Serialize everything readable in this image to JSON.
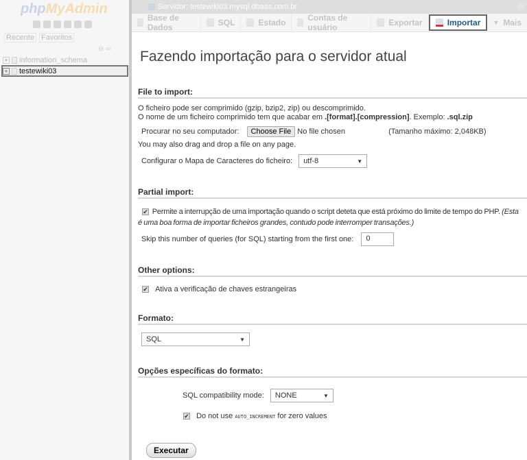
{
  "sidebar": {
    "logo_a": "php",
    "logo_b": "MyAdmin",
    "tabs": [
      "Recente",
      "Favoritos"
    ],
    "databases": [
      {
        "name": "information_schema"
      },
      {
        "name": "testewiki03"
      }
    ]
  },
  "topbar": {
    "server": "Servidor: testewiki03.mysql.dbaas.com.br"
  },
  "tabs": [
    {
      "label": "Base de Dados"
    },
    {
      "label": "SQL"
    },
    {
      "label": "Estado"
    },
    {
      "label": "Contas de usuário"
    },
    {
      "label": "Exportar"
    },
    {
      "label": "Importar",
      "active": true
    },
    {
      "label": "Mais"
    }
  ],
  "main": {
    "title": "Fazendo importação para o servidor atual",
    "file": {
      "heading": "File to import:",
      "line1": "O ficheiro pode ser comprimido (gzip, bzip2, zip) ou descomprimido.",
      "line2a": "O nome de um ficheiro comprimido tem que acabar em ",
      "line2b": ".[format].[compression]",
      "line2c": ". Exemplo: ",
      "line2d": ".sql.zip",
      "browse_label": "Procurar no seu computador:",
      "choose_button": "Choose File",
      "no_file": "No file chosen",
      "max_size": "(Tamanho máximo: 2,048KB)",
      "drag_text": "You may also drag and drop a file on any page.",
      "charset_label": "Configurar o Mapa de Caracteres do ficheiro:",
      "charset_value": "utf-8"
    },
    "partial": {
      "heading": "Partial import:",
      "allow_interrupt": "Permite a interrupção de uma importação quando o script deteta que está próximo do limite de tempo do PHP.",
      "allow_note_a": "(Esta",
      "allow_note_b": "é uma boa forma de importar ficheiros grandes, contudo pode interromper transações.)",
      "allow_checked": true,
      "skip_label": "Skip this number of queries (for SQL) starting from the first one:",
      "skip_value": "0"
    },
    "other": {
      "heading": "Other options:",
      "fk_label": "Ativa a verificação de chaves estrangeiras",
      "fk_checked": true
    },
    "format": {
      "heading": "Formato:",
      "value": "SQL"
    },
    "format_options": {
      "heading": "Opções específicas do formato:",
      "compat_label": "SQL compatibility mode:",
      "compat_value": "NONE",
      "ai_a": "Do not use ",
      "ai_code": "AUTO_INCREMENT",
      "ai_b": " for zero values",
      "ai_checked": true
    },
    "execute_button": "Executar"
  }
}
